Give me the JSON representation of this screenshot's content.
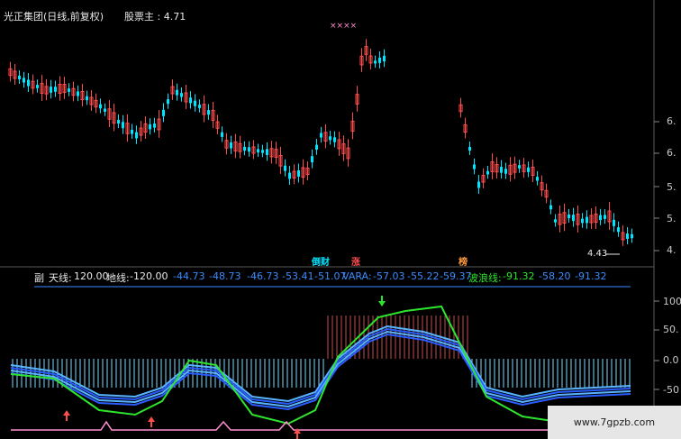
{
  "header": {
    "title": "光正集团(日线,前复权)",
    "price_label": "股票主 : 4.71",
    "stars": "××××"
  },
  "price_axis": [
    "6.",
    "6.",
    "5.",
    "5.",
    "4."
  ],
  "low_label": "4.43",
  "indicator": {
    "prefix": "副",
    "tian_label": "天线:",
    "tian_value": "120.00",
    "di_label": "地线:",
    "di_value": "-120.00",
    "blue_values": [
      "-44.73",
      "-48.73",
      "-46.73",
      "-53.41",
      "-51.07"
    ],
    "vara_label": "VARA:",
    "vara_values": [
      "-57.03",
      "-55.22",
      "-59.37"
    ],
    "wave_label": "波浪线:",
    "wave_values": [
      "-91.32",
      "-58.20",
      "-91.32"
    ]
  },
  "signals": {
    "s1": "倒财",
    "s2": "涨",
    "s3": "榜"
  },
  "sub_axis": [
    "100",
    "50.",
    "0.0",
    "-50"
  ],
  "watermark": "www.7gpzb.com",
  "colors": {
    "up": "#ff4d4d",
    "down": "#00e5ff",
    "green": "#2ee52e",
    "blue": "#3a8cff",
    "pink": "#ff8fd0"
  }
}
